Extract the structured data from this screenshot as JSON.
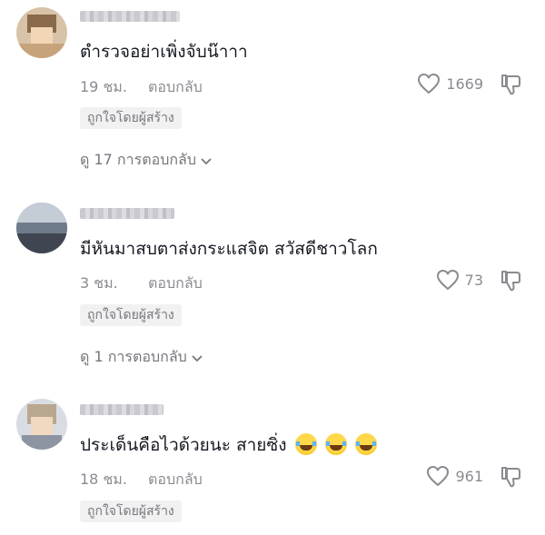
{
  "comments": [
    {
      "text": "ตำรวจอย่าเพิ่งจับน๊าาา",
      "time": "19 ชม.",
      "reply_label": "ตอบกลับ",
      "likes": "1669",
      "badge": "ถูกใจโดยผู้สร้าง",
      "view_replies": "ดู 17 การตอบกลับ",
      "emoji_count": 0
    },
    {
      "text": "มีหันมาสบตาส่งกระแสจิต สวัสดีชาวโลก",
      "time": "3 ชม.",
      "reply_label": "ตอบกลับ",
      "likes": "73",
      "badge": "ถูกใจโดยผู้สร้าง",
      "view_replies": "ดู 1 การตอบกลับ",
      "emoji_count": 0
    },
    {
      "text": "ประเด็นคือไวด้วยนะ สายซิ่ง",
      "time": "18 ชม.",
      "reply_label": "ตอบกลับ",
      "likes": "961",
      "badge": "ถูกใจโดยผู้สร้าง",
      "emoji": "face-with-tears-of-joy",
      "emoji_count": 3
    }
  ],
  "colors": {
    "text": "#161823",
    "meta": "#8a8b91",
    "badge_bg": "#f1f1f2"
  }
}
